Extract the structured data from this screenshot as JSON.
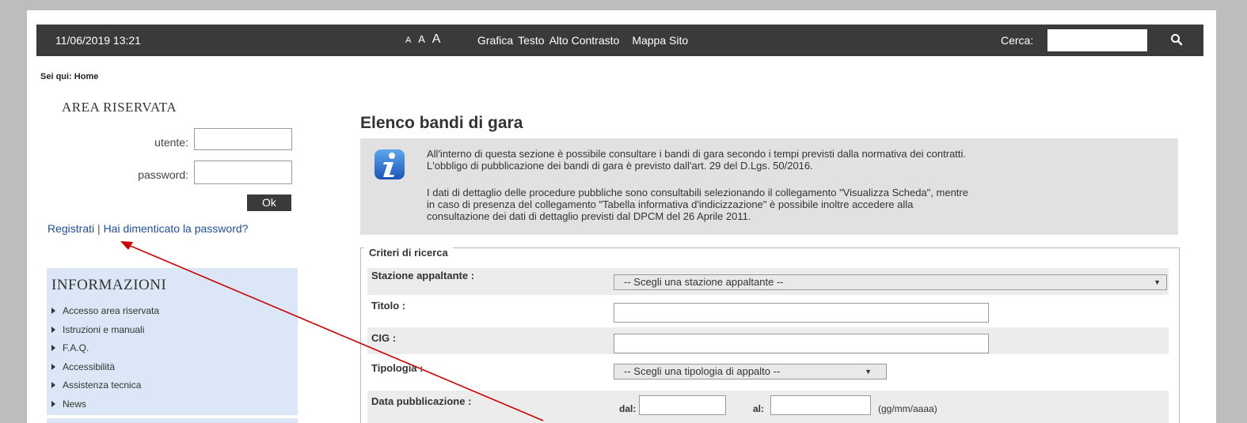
{
  "topbar": {
    "datetime": "11/06/2019 13:21",
    "font_sizes": [
      "A",
      "A",
      "A"
    ],
    "links": [
      "Grafica",
      "Testo",
      "Alto Contrasto",
      "Mappa Sito"
    ],
    "search_label": "Cerca:",
    "search_value": "",
    "search_icon": "search-icon"
  },
  "breadcrumb": "Sei qui: Home",
  "login": {
    "title": "AREA RISERVATA",
    "user_label": "utente:",
    "user_value": "",
    "password_label": "password:",
    "password_value": "",
    "ok_label": "Ok",
    "register_link": "Registrati",
    "separator": "|",
    "forgot_link": "Hai dimenticato la password?"
  },
  "info": {
    "title": "INFORMAZIONI",
    "items": [
      "Accesso area riservata",
      "Istruzioni e manuali",
      "F.A.Q.",
      "Accessibilità",
      "Assistenza tecnica",
      "News"
    ]
  },
  "main": {
    "title": "Elenco bandi di gara",
    "info_icon": "info-icon",
    "notice_line1": "All'interno di questa sezione è possibile consultare i bandi di gara secondo i tempi previsti dalla normativa dei contratti.",
    "notice_line2": "L'obbligo di pubblicazione dei bandi di gara è previsto dall'art. 29 del D.Lgs. 50/2016.",
    "notice_line3": "I dati di dettaglio delle procedure pubbliche sono consultabili selezionando il collegamento \"Visualizza Scheda\", mentre",
    "notice_line4": "in caso di presenza del collegamento \"Tabella informativa d'indicizzazione\" è possibile inoltre accedere alla",
    "notice_line5": "consultazione dei dati di dettaglio previsti dal DPCM del 26 Aprile 2011."
  },
  "criteria": {
    "legend": "Criteri di ricerca",
    "stazione_label": "Stazione appaltante :",
    "stazione_value": "-- Scegli una stazione appaltante --",
    "titolo_label": "Titolo :",
    "titolo_value": "",
    "cig_label": "CIG :",
    "cig_value": "",
    "tipologia_label": "Tipologia :",
    "tipologia_value": "-- Scegli una tipologia di appalto --",
    "data_label": "Data pubblicazione :",
    "dal_label": "dal:",
    "dal_value": "",
    "al_label": "al:",
    "al_value": "",
    "format_hint": "(gg/mm/aaaa)"
  },
  "annotation": {
    "arrow_color": "#cc0000"
  }
}
